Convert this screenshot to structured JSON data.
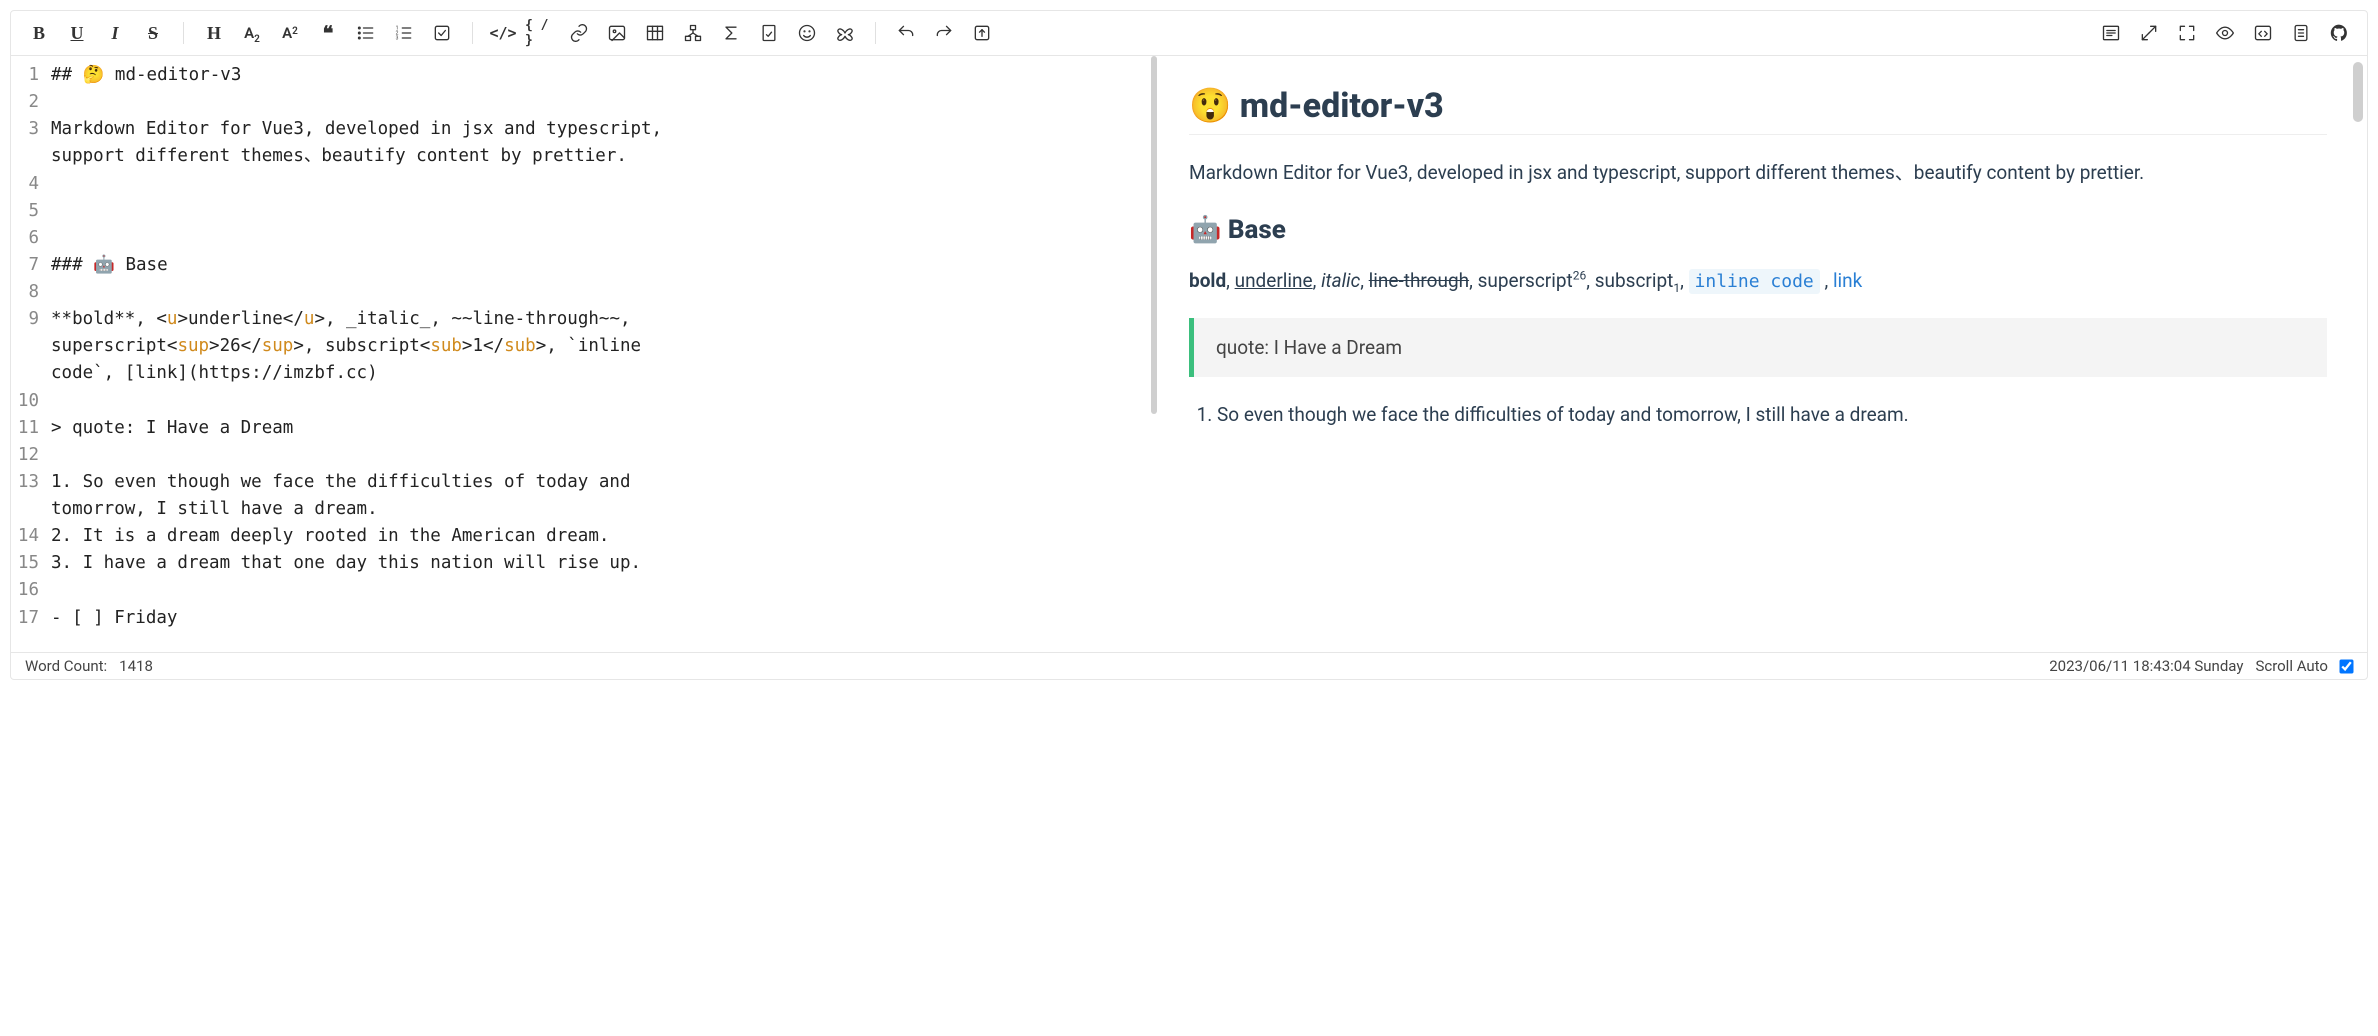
{
  "toolbar": {
    "bold": "B",
    "underline": "U",
    "italic": "I",
    "strike": "S",
    "heading": "H",
    "sub_base": "A",
    "sub_mark": "2",
    "sup_base": "A",
    "sup_mark": "2",
    "quote_glyph": "❝",
    "code_label": "</>",
    "brace_label": "{ / }"
  },
  "source": {
    "line_count": 17,
    "lines": {
      "l1": "## 🤔 md-editor-v3",
      "l2": "",
      "l3a": "Markdown Editor for Vue3, developed in jsx and typescript, ",
      "l3b": "support different themes、beautify content by prettier.",
      "l4": "",
      "l5": "",
      "l6": "",
      "l7": "### 🤖 Base",
      "l8": "",
      "l9_pre": "**bold**, <",
      "l9_u": "u",
      "l9_mid": ">underline</",
      "l9_u2": "u",
      "l9_post": ">, _italic_, ~~line-through~~, ",
      "l9b_pre": "superscript<",
      "l9b_sup": "sup",
      "l9b_mid": ">26</",
      "l9b_sup2": "sup",
      "l9b_post": ">, subscript<",
      "l9b_sub": "sub",
      "l9b_mid2": ">1</",
      "l9b_sub2": "sub",
      "l9b_post2": ">, `inline ",
      "l9c": "code`, [link](https://imzbf.cc)",
      "l10": "",
      "l11": "> quote: I Have a Dream",
      "l12": "",
      "l13a": "1. So even though we face the difficulties of today and ",
      "l13b": "tomorrow, I still have a dream.",
      "l14": "2. It is a dream deeply rooted in the American dream.",
      "l15": "3. I have a dream that one day this nation will rise up.",
      "l16": "",
      "l17": "- [ ] Friday"
    }
  },
  "preview": {
    "h2": "😲 md-editor-v3",
    "desc": "Markdown Editor for Vue3, developed in jsx and typescript, support different themes、beautify content by prettier.",
    "h3": "🤖 Base",
    "fmt": {
      "bold": "bold",
      "underline": "underline",
      "italic": "italic",
      "strike": "line-through",
      "sup_label": "superscript",
      "sup_val": "26",
      "sub_label": "subscript",
      "sub_val": "1",
      "code": "inline code",
      "link": "link"
    },
    "quote": "quote: I Have a Dream",
    "list": {
      "i1": "So even though we face the difficulties of today and tomorrow, I still have a dream."
    }
  },
  "status": {
    "word_count_label": "Word Count:",
    "word_count_value": "1418",
    "timestamp": "2023/06/11 18:43:04 Sunday",
    "scroll_label": "Scroll Auto"
  }
}
